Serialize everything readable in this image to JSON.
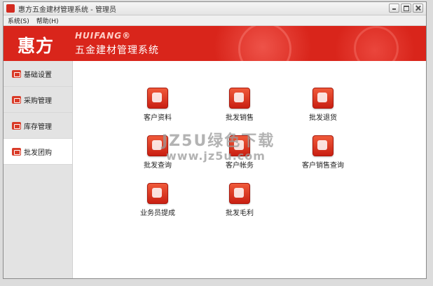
{
  "window": {
    "title": "惠方五金建材管理系统 - 管理员"
  },
  "menubar": {
    "items": [
      "系统(S)",
      "帮助(H)"
    ]
  },
  "banner": {
    "logo_cn": "惠方",
    "logo_en": "HUIFANG®",
    "subtitle": "五金建材管理系统"
  },
  "sidebar": {
    "items": [
      {
        "label": "基础设置",
        "icon": "settings-icon",
        "active": false
      },
      {
        "label": "采购管理",
        "icon": "purchase-icon",
        "active": false
      },
      {
        "label": "库存管理",
        "icon": "inventory-icon",
        "active": false
      },
      {
        "label": "批发团购",
        "icon": "wholesale-icon",
        "active": true
      }
    ]
  },
  "tiles": [
    {
      "label": "客户资料",
      "icon": "customer-profile-icon"
    },
    {
      "label": "批发销售",
      "icon": "truck-icon"
    },
    {
      "label": "批发退货",
      "icon": "return-icon"
    },
    {
      "label": "批发查询",
      "icon": "query-icon"
    },
    {
      "label": "客户帐务",
      "icon": "account-icon"
    },
    {
      "label": "客户销售查询",
      "icon": "sales-query-icon"
    },
    {
      "label": "业务员提成",
      "icon": "commission-icon"
    },
    {
      "label": "批发毛利",
      "icon": "profit-chart-icon"
    }
  ],
  "watermark": {
    "line1": "JZ5U绿色下载",
    "line2": "www.jz5u.com"
  },
  "colors": {
    "brand_red": "#d9251b",
    "sidebar_bg": "#e3e3e3"
  }
}
